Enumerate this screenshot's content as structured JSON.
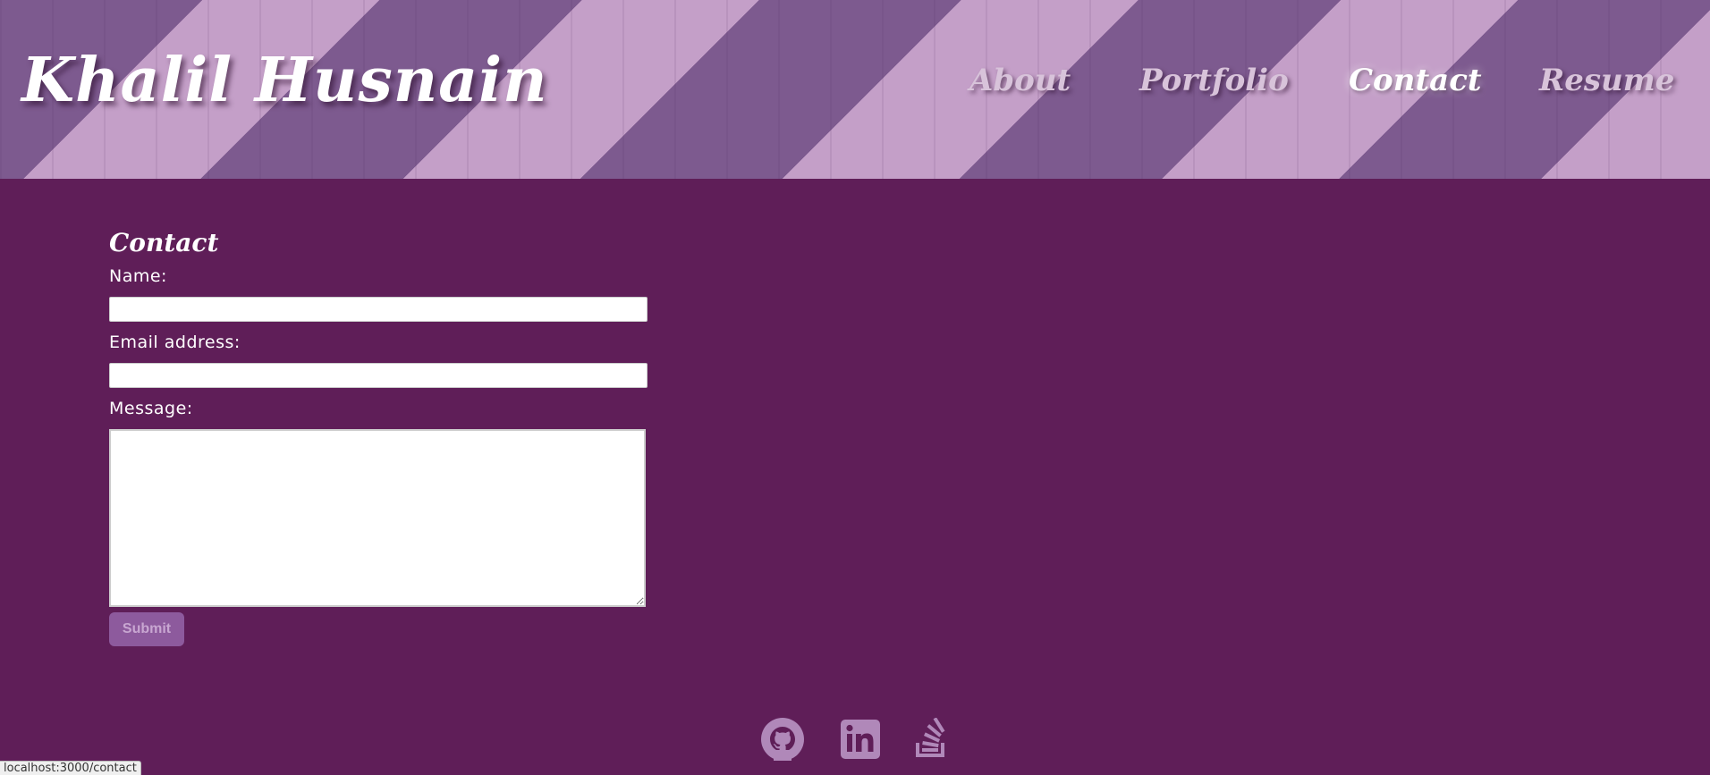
{
  "header": {
    "brand": "Khalil Husnain",
    "nav": [
      {
        "label": "About",
        "active": false
      },
      {
        "label": "Portfolio",
        "active": false
      },
      {
        "label": "Contact",
        "active": true
      },
      {
        "label": "Resume",
        "active": false
      }
    ]
  },
  "contact": {
    "title": "Contact",
    "name_label": "Name:",
    "name_value": "",
    "email_label": "Email address:",
    "email_value": "",
    "message_label": "Message:",
    "message_value": "",
    "submit_label": "Submit"
  },
  "footer": {
    "icons": [
      "github-icon",
      "linkedin-icon",
      "stackoverflow-icon"
    ]
  },
  "status_bar": {
    "url": "localhost:3000/contact"
  },
  "colors": {
    "background": "#5f1e58",
    "header_dark_stripe": "#7d5a8f",
    "header_light_stripe": "#c49fc8",
    "nav_inactive": "#d8c3da",
    "nav_active": "#ffffff",
    "submit_bg": "#8d5a9d",
    "icon_color": "#b088b9"
  }
}
